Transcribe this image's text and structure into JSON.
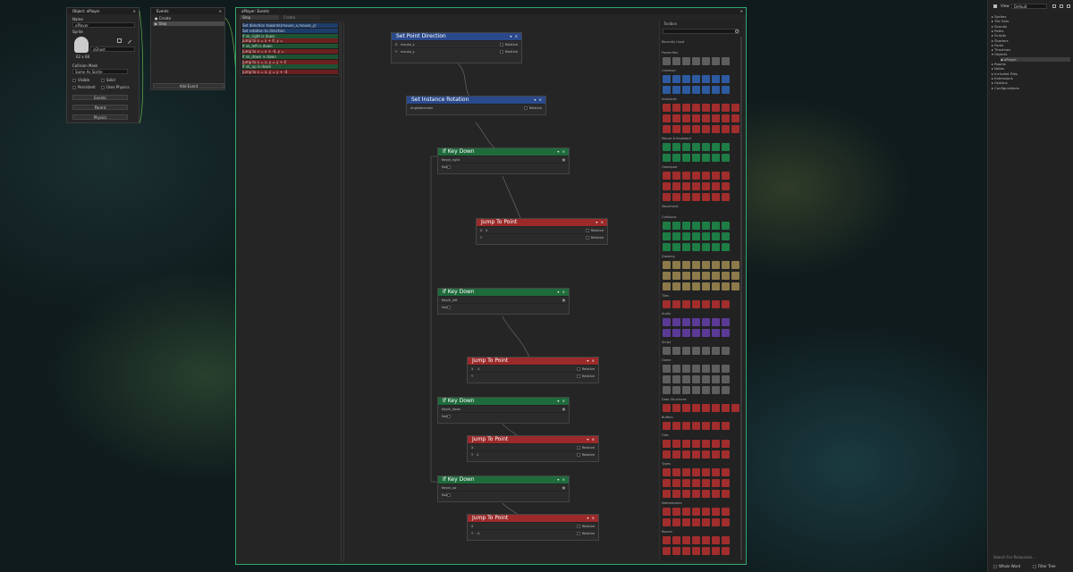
{
  "object_panel": {
    "title": "Object: oPlayer",
    "name_label": "Name",
    "name_value": "oPlayer",
    "sprite_label": "Sprite",
    "sprite_name": "sGhost",
    "sprite_size": "62 x 68",
    "mask_label": "Collision Mask",
    "mask_value": "Same As Sprite",
    "visible": "Visible",
    "solid": "Solid",
    "persistent": "Persistent",
    "uses_physics": "Uses Physics",
    "events_btn": "Events",
    "parent_btn": "Parent",
    "physics_btn": "Physics"
  },
  "events_panel": {
    "title": "Events",
    "items": [
      "Create",
      "Step"
    ],
    "add_event": "Add Event"
  },
  "editor": {
    "title": "oPlayer: Events",
    "tabs": [
      "Step",
      "Create"
    ],
    "code_lines": [
      {
        "text": "Set direction towards(mouse_x,mouse_y)",
        "c": "#d1d1d1"
      },
      {
        "text": "Set rotation to direction",
        "c": "#d1d1d1"
      },
      {
        "text": "If vk_right is down",
        "c": "#d1d1d1"
      },
      {
        "text": "  Jump to x = x + 4, y = ",
        "c": "#d1d1d1"
      },
      {
        "text": "If vk_left is down",
        "c": "#d1d1d1"
      },
      {
        "text": "  Jump to x = x + -4, y = ",
        "c": "#d1d1d1"
      },
      {
        "text": "If vk_down is down",
        "c": "#d1d1d1"
      },
      {
        "text": "  Jump to x = x, y = y + 4",
        "c": "#d1d1d1"
      },
      {
        "text": "If vk_up is down",
        "c": "#d1d1d1"
      },
      {
        "text": "  Jump to x = x, y = y + -4",
        "c": "#d1d1d1"
      }
    ],
    "nodes": {
      "n1": {
        "title": "Set Point Direction",
        "r1l": "X",
        "r1v": "mouse_x",
        "r1r": "Relative",
        "r2l": "Y",
        "r2v": "mouse_y",
        "r2r": "Relative"
      },
      "n2": {
        "title": "Set Instance Rotation",
        "r1l": "Angle",
        "r1v": "direction",
        "r1r": "Relative"
      },
      "n3": {
        "title": "If Key Down",
        "r1l": "Key",
        "r1v": "vk_right",
        "r2l": "Not"
      },
      "n4": {
        "title": "Jump To Point",
        "r1l": "X",
        "r1v": "4",
        "r1r": "Relative",
        "r2l": "Y",
        "r2v": "",
        "r2r": "Relative"
      },
      "n5": {
        "title": "If Key Down",
        "r1l": "Key",
        "r1v": "vk_left",
        "r2l": "Not"
      },
      "n6": {
        "title": "Jump To Point",
        "r1l": "X",
        "r1v": "-4",
        "r1r": "Relative",
        "r2l": "Y",
        "r2v": "",
        "r2r": "Relative"
      },
      "n7": {
        "title": "If Key Down",
        "r1l": "Key",
        "r1v": "vk_down",
        "r2l": "Not"
      },
      "n8": {
        "title": "Jump To Point",
        "r1l": "X",
        "r1v": "",
        "r1r": "Relative",
        "r2l": "Y",
        "r2v": "4",
        "r2r": "Relative"
      },
      "n9": {
        "title": "If Key Down",
        "r1l": "Key",
        "r1v": "vk_up",
        "r2l": "Not"
      },
      "n10": {
        "title": "Jump To Point",
        "r1l": "X",
        "r1v": "",
        "r1r": "Relative",
        "r2l": "Y",
        "r2v": "-4",
        "r2r": "Relative"
      }
    }
  },
  "toolbox": {
    "title": "Toolbox",
    "categories": [
      "Recently Used",
      "Favourites",
      "Common",
      "Instances",
      "Mouse & Keyboard",
      "Gamepad",
      "Movement",
      "Collisions",
      "Drawing",
      "Tiles",
      "Audio",
      "Script",
      "Game",
      "Data Structures",
      "Buffers",
      "Files",
      "Types",
      "Mathematics",
      "Rooms"
    ]
  },
  "resources": {
    "view_label": "View",
    "view_value": "Default",
    "items": [
      "Sprites",
      "Tile Sets",
      "Sounds",
      "Paths",
      "Scripts",
      "Shaders",
      "Fonts",
      "Timelines",
      "Objects",
      "oPlayer",
      "Rooms",
      "Notes",
      "Included Files",
      "Extensions",
      "Options",
      "Configurations"
    ],
    "search": "Search For Resources...",
    "whole_word": "Whole Word",
    "filter_tree": "Filter Tree"
  },
  "colors": {
    "accent": "#2ea870",
    "blue": "#2a4a8c",
    "green": "#1f6b3c",
    "red": "#9c2a2a"
  }
}
